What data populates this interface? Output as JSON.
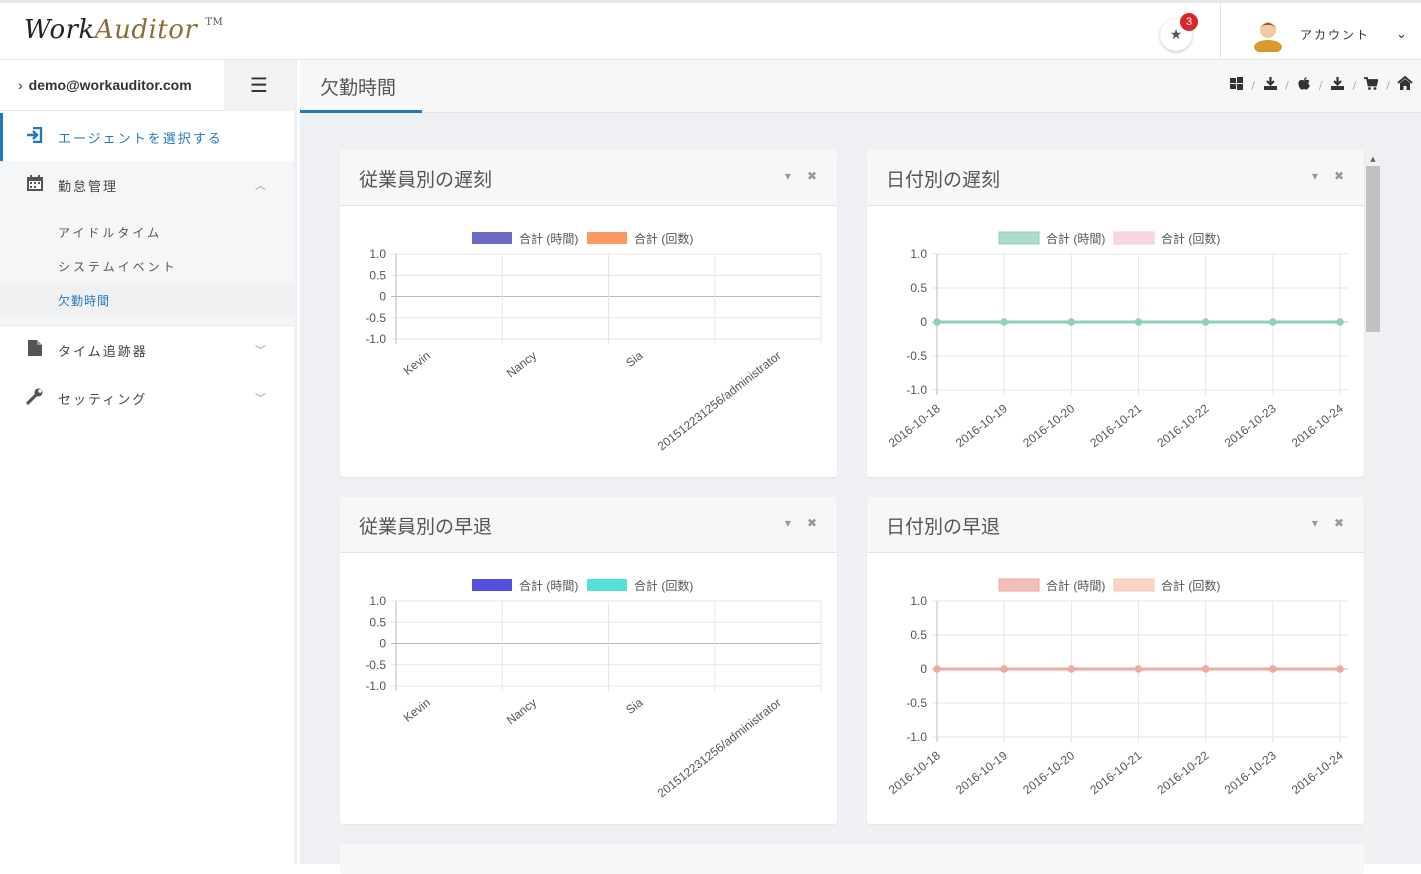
{
  "app": {
    "logo_work": "Work",
    "logo_auditor": "Auditor",
    "logo_tm": "TM"
  },
  "header": {
    "notifications": {
      "icon": "star-icon",
      "count": "3"
    },
    "account_label": "アカウント"
  },
  "sidebar": {
    "email": "demo@workauditor.com",
    "items": [
      {
        "label": "エージェントを選択する",
        "icon": "sign-in-icon"
      },
      {
        "label": "勤怠管理",
        "icon": "calendar-icon"
      },
      {
        "label": "タイム追跡器",
        "icon": "file-icon"
      },
      {
        "label": "セッティング",
        "icon": "wrench-icon"
      }
    ],
    "sub_items": [
      {
        "label": "アイドルタイム"
      },
      {
        "label": "システムイベント"
      },
      {
        "label": "欠勤時間"
      }
    ]
  },
  "page": {
    "title": "欠勤時間"
  },
  "panels": [
    {
      "title": "従業員別の遅刻"
    },
    {
      "title": "日付別の遅刻"
    },
    {
      "title": "従業員別の早退"
    },
    {
      "title": "日付別の早退"
    }
  ],
  "chart_data": [
    {
      "type": "bar",
      "title": "従業員別の遅刻",
      "categories": [
        "Kevin",
        "Nancy",
        "Sia",
        "201512231256/administrator"
      ],
      "series": [
        {
          "name": "合計 (時間)",
          "values": [
            0,
            0,
            0,
            0
          ],
          "color": "#6b6bc5"
        },
        {
          "name": "合計 (回数)",
          "values": [
            0,
            0,
            0,
            0
          ],
          "color": "#fb9a60"
        }
      ],
      "yticks": [
        "1.0",
        "0.5",
        "0",
        "-0.5",
        "-1.0"
      ],
      "ylim": [
        -1,
        1
      ],
      "legend": "top"
    },
    {
      "type": "line",
      "title": "日付別の遅刻",
      "categories": [
        "2016-10-18",
        "2016-10-19",
        "2016-10-20",
        "2016-10-21",
        "2016-10-22",
        "2016-10-23",
        "2016-10-24"
      ],
      "series": [
        {
          "name": "合計 (時間)",
          "values": [
            0,
            0,
            0,
            0,
            0,
            0,
            0
          ],
          "color": "#8fd1b5"
        },
        {
          "name": "合計 (回数)",
          "values": [
            0,
            0,
            0,
            0,
            0,
            0,
            0
          ],
          "color": "#f4c9d8"
        }
      ],
      "yticks": [
        "1.0",
        "0.5",
        "0",
        "-0.5",
        "-1.0"
      ],
      "ylim": [
        -1,
        1
      ],
      "legend": "top"
    },
    {
      "type": "bar",
      "title": "従業員別の早退",
      "categories": [
        "Kevin",
        "Nancy",
        "Sia",
        "201512231256/administrator"
      ],
      "series": [
        {
          "name": "合計 (時間)",
          "values": [
            0,
            0,
            0,
            0
          ],
          "color": "#5450e0"
        },
        {
          "name": "合計 (回数)",
          "values": [
            0,
            0,
            0,
            0
          ],
          "color": "#55e1d8"
        }
      ],
      "yticks": [
        "1.0",
        "0.5",
        "0",
        "-0.5",
        "-1.0"
      ],
      "ylim": [
        -1,
        1
      ],
      "legend": "top"
    },
    {
      "type": "line",
      "title": "日付別の早退",
      "categories": [
        "2016-10-18",
        "2016-10-19",
        "2016-10-20",
        "2016-10-21",
        "2016-10-22",
        "2016-10-23",
        "2016-10-24"
      ],
      "series": [
        {
          "name": "合計 (時間)",
          "values": [
            0,
            0,
            0,
            0,
            0,
            0,
            0
          ],
          "color": "#eeaaa0"
        },
        {
          "name": "合計 (回数)",
          "values": [
            0,
            0,
            0,
            0,
            0,
            0,
            0
          ],
          "color": "#f8c7b0"
        }
      ],
      "yticks": [
        "1.0",
        "0.5",
        "0",
        "-0.5",
        "-1.0"
      ],
      "ylim": [
        -1,
        1
      ],
      "legend": "top"
    }
  ]
}
